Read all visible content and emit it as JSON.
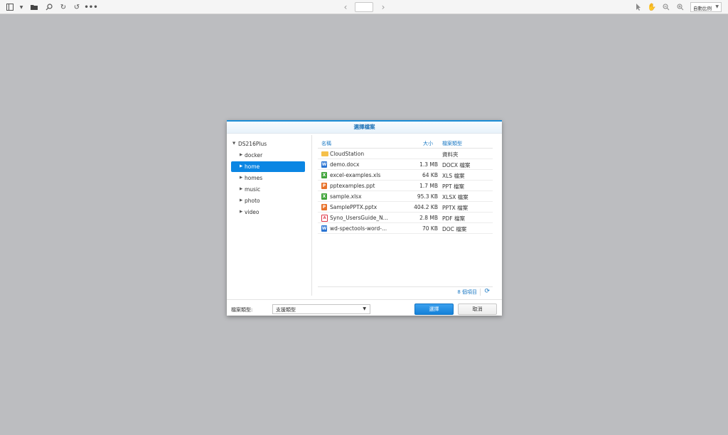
{
  "toolbar": {
    "icons": [
      "sidebar-icon",
      "dropdown-arrow-icon",
      "open-folder-icon",
      "search-icon",
      "rotate-icon",
      "undo-icon",
      "more-icon",
      "prev-page-icon",
      "next-page-icon",
      "pointer-icon",
      "hand-icon",
      "zoom-out-icon",
      "zoom-in-icon"
    ],
    "page_number": "",
    "zoom_label": "自動比例"
  },
  "dialog": {
    "title": "選擇檔案",
    "tree": {
      "root": "DS216Plus",
      "items": [
        {
          "label": "docker",
          "selected": false
        },
        {
          "label": "home",
          "selected": true
        },
        {
          "label": "homes",
          "selected": false
        },
        {
          "label": "music",
          "selected": false
        },
        {
          "label": "photo",
          "selected": false
        },
        {
          "label": "video",
          "selected": false
        }
      ]
    },
    "columns": {
      "name": "名稱",
      "size": "大小",
      "type": "檔案類型"
    },
    "files": [
      {
        "icon": "folder-icon",
        "name": "CloudStation",
        "size": "",
        "type": "資料夾"
      },
      {
        "icon": "word-icon",
        "name": "demo.docx",
        "size": "1.3 MB",
        "type": "DOCX 檔案"
      },
      {
        "icon": "excel-icon",
        "name": "excel-examples.xls",
        "size": "64 KB",
        "type": "XLS 檔案"
      },
      {
        "icon": "powerpoint-icon",
        "name": "pptexamples.ppt",
        "size": "1.7 MB",
        "type": "PPT 檔案"
      },
      {
        "icon": "excel-icon",
        "name": "sample.xlsx",
        "size": "95.3 KB",
        "type": "XLSX 檔案"
      },
      {
        "icon": "powerpoint-icon",
        "name": "SamplePPTX.pptx",
        "size": "404.2 KB",
        "type": "PPTX 檔案"
      },
      {
        "icon": "pdf-icon",
        "name": "Syno_UsersGuide_N...",
        "size": "2.8 MB",
        "type": "PDF 檔案"
      },
      {
        "icon": "word-icon",
        "name": "wd-spectools-word-...",
        "size": "70 KB",
        "type": "DOC 檔案"
      }
    ],
    "item_count": "8 個項目",
    "file_type_label": "檔案類型:",
    "file_type_value": "支援類型",
    "ok_label": "選擇",
    "cancel_label": "取消"
  }
}
